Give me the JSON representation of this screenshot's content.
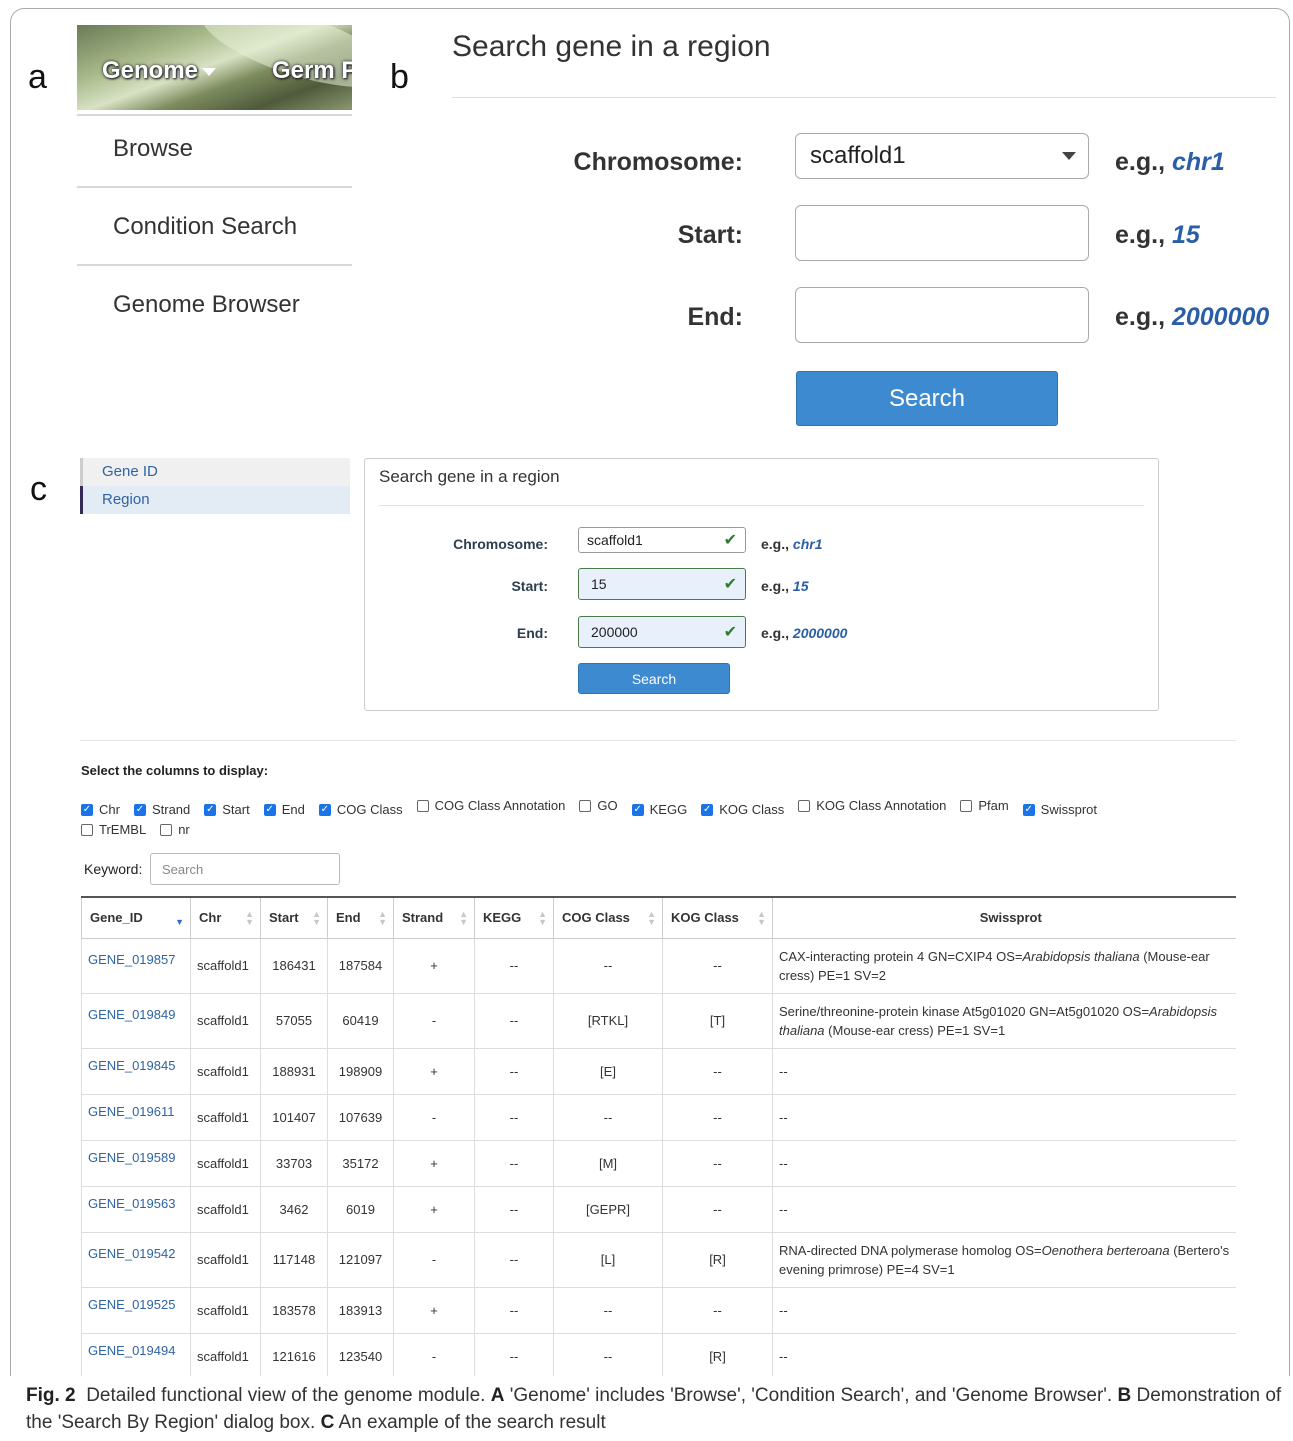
{
  "panel_a": {
    "letter": "a",
    "nav_tabs": [
      "Genome",
      "Germ P"
    ],
    "menu_items": [
      "Browse",
      "Condition Search",
      "Genome Browser"
    ]
  },
  "panel_b": {
    "letter": "b",
    "title": "Search gene in a region",
    "chromosome_label": "Chromosome:",
    "chromosome_value": "scaffold1",
    "start_label": "Start:",
    "start_value": "",
    "end_label": "End:",
    "end_value": "",
    "eg_prefix": "e.g.,",
    "eg_chromosome": "chr1",
    "eg_start": "15",
    "eg_end": "2000000",
    "search_label": "Search"
  },
  "panel_c": {
    "letter": "c",
    "sidebar": [
      "Gene ID",
      "Region"
    ],
    "title": "Search gene in a region",
    "chromosome_label": "Chromosome:",
    "chromosome_value": "scaffold1",
    "start_label": "Start:",
    "start_value": "15",
    "end_label": "End:",
    "end_value": "200000",
    "eg_prefix": "e.g.,",
    "eg_chromosome": "chr1",
    "eg_start": "15",
    "eg_end": "2000000",
    "search_label": "Search",
    "columns_title": "Select the columns to display:",
    "columns": [
      {
        "label": "Chr",
        "checked": true
      },
      {
        "label": "Strand",
        "checked": true
      },
      {
        "label": "Start",
        "checked": true
      },
      {
        "label": "End",
        "checked": true
      },
      {
        "label": "COG Class",
        "checked": true
      },
      {
        "label": "COG Class Annotation",
        "checked": false
      },
      {
        "label": "GO",
        "checked": false
      },
      {
        "label": "KEGG",
        "checked": true
      },
      {
        "label": "KOG Class",
        "checked": true
      },
      {
        "label": "KOG Class Annotation",
        "checked": false
      },
      {
        "label": "Pfam",
        "checked": false
      },
      {
        "label": "Swissprot",
        "checked": true
      },
      {
        "label": "TrEMBL",
        "checked": false
      },
      {
        "label": "nr",
        "checked": false
      }
    ],
    "keyword_label": "Keyword:",
    "keyword_placeholder": "Search",
    "table_headers": [
      "Gene_ID",
      "Chr",
      "Start",
      "End",
      "Strand",
      "KEGG",
      "COG Class",
      "KOG Class",
      "Swissprot"
    ],
    "rows": [
      {
        "gene": "GENE_019857",
        "chr": "scaffold1",
        "start": "186431",
        "end": "187584",
        "strand": "+",
        "kegg": "--",
        "cog": "--",
        "kog": "--",
        "swiss_pre": "CAX-interacting protein 4 GN=CXIP4 OS=",
        "swiss_it": "Arabidopsis thaliana",
        "swiss_post": " (Mouse-ear cress) PE=1 SV=2"
      },
      {
        "gene": "GENE_019849",
        "chr": "scaffold1",
        "start": "57055",
        "end": "60419",
        "strand": "-",
        "kegg": "--",
        "cog": "[RTKL]",
        "kog": "[T]",
        "swiss_pre": "Serine/threonine-protein kinase At5g01020 GN=At5g01020 OS=",
        "swiss_it": "Arabidopsis thaliana",
        "swiss_post": " (Mouse-ear cress) PE=1 SV=1"
      },
      {
        "gene": "GENE_019845",
        "chr": "scaffold1",
        "start": "188931",
        "end": "198909",
        "strand": "+",
        "kegg": "--",
        "cog": "[E]",
        "kog": "--",
        "swiss_pre": "--",
        "swiss_it": "",
        "swiss_post": ""
      },
      {
        "gene": "GENE_019611",
        "chr": "scaffold1",
        "start": "101407",
        "end": "107639",
        "strand": "-",
        "kegg": "--",
        "cog": "--",
        "kog": "--",
        "swiss_pre": "--",
        "swiss_it": "",
        "swiss_post": ""
      },
      {
        "gene": "GENE_019589",
        "chr": "scaffold1",
        "start": "33703",
        "end": "35172",
        "strand": "+",
        "kegg": "--",
        "cog": "[M]",
        "kog": "--",
        "swiss_pre": "--",
        "swiss_it": "",
        "swiss_post": ""
      },
      {
        "gene": "GENE_019563",
        "chr": "scaffold1",
        "start": "3462",
        "end": "6019",
        "strand": "+",
        "kegg": "--",
        "cog": "[GEPR]",
        "kog": "--",
        "swiss_pre": "--",
        "swiss_it": "",
        "swiss_post": ""
      },
      {
        "gene": "GENE_019542",
        "chr": "scaffold1",
        "start": "117148",
        "end": "121097",
        "strand": "-",
        "kegg": "--",
        "cog": "[L]",
        "kog": "[R]",
        "swiss_pre": "RNA-directed DNA polymerase homolog OS=",
        "swiss_it": "Oenothera berteroana",
        "swiss_post": " (Bertero's evening primrose) PE=4 SV=1"
      },
      {
        "gene": "GENE_019525",
        "chr": "scaffold1",
        "start": "183578",
        "end": "183913",
        "strand": "+",
        "kegg": "--",
        "cog": "--",
        "kog": "--",
        "swiss_pre": "--",
        "swiss_it": "",
        "swiss_post": ""
      },
      {
        "gene": "GENE_019494",
        "chr": "scaffold1",
        "start": "121616",
        "end": "123540",
        "strand": "-",
        "kegg": "--",
        "cog": "--",
        "kog": "[R]",
        "swiss_pre": "--",
        "swiss_it": "",
        "swiss_post": ""
      }
    ]
  },
  "caption": {
    "fig_label": "Fig. 2",
    "t1": "Detailed functional view of the genome module.",
    "a": "A",
    "t2": "'Genome' includes 'Browse', 'Condition Search', and 'Genome Browser'.",
    "b": "B",
    "t3": "Demonstration of the 'Search By Region' dialog box.",
    "c": "C",
    "t4": "An example of the search result"
  }
}
